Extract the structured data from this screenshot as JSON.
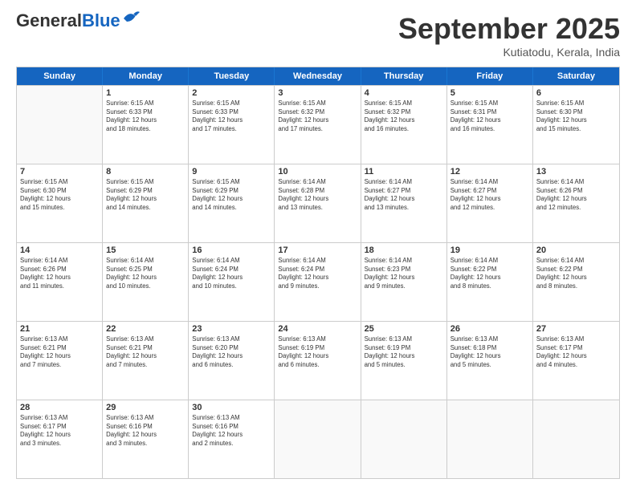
{
  "header": {
    "logo_general": "General",
    "logo_blue": "Blue",
    "month": "September 2025",
    "location": "Kutiatodu, Kerala, India"
  },
  "weekdays": [
    "Sunday",
    "Monday",
    "Tuesday",
    "Wednesday",
    "Thursday",
    "Friday",
    "Saturday"
  ],
  "rows": [
    [
      {
        "day": "",
        "info": ""
      },
      {
        "day": "1",
        "info": "Sunrise: 6:15 AM\nSunset: 6:33 PM\nDaylight: 12 hours\nand 18 minutes."
      },
      {
        "day": "2",
        "info": "Sunrise: 6:15 AM\nSunset: 6:33 PM\nDaylight: 12 hours\nand 17 minutes."
      },
      {
        "day": "3",
        "info": "Sunrise: 6:15 AM\nSunset: 6:32 PM\nDaylight: 12 hours\nand 17 minutes."
      },
      {
        "day": "4",
        "info": "Sunrise: 6:15 AM\nSunset: 6:32 PM\nDaylight: 12 hours\nand 16 minutes."
      },
      {
        "day": "5",
        "info": "Sunrise: 6:15 AM\nSunset: 6:31 PM\nDaylight: 12 hours\nand 16 minutes."
      },
      {
        "day": "6",
        "info": "Sunrise: 6:15 AM\nSunset: 6:30 PM\nDaylight: 12 hours\nand 15 minutes."
      }
    ],
    [
      {
        "day": "7",
        "info": "Sunrise: 6:15 AM\nSunset: 6:30 PM\nDaylight: 12 hours\nand 15 minutes."
      },
      {
        "day": "8",
        "info": "Sunrise: 6:15 AM\nSunset: 6:29 PM\nDaylight: 12 hours\nand 14 minutes."
      },
      {
        "day": "9",
        "info": "Sunrise: 6:15 AM\nSunset: 6:29 PM\nDaylight: 12 hours\nand 14 minutes."
      },
      {
        "day": "10",
        "info": "Sunrise: 6:14 AM\nSunset: 6:28 PM\nDaylight: 12 hours\nand 13 minutes."
      },
      {
        "day": "11",
        "info": "Sunrise: 6:14 AM\nSunset: 6:27 PM\nDaylight: 12 hours\nand 13 minutes."
      },
      {
        "day": "12",
        "info": "Sunrise: 6:14 AM\nSunset: 6:27 PM\nDaylight: 12 hours\nand 12 minutes."
      },
      {
        "day": "13",
        "info": "Sunrise: 6:14 AM\nSunset: 6:26 PM\nDaylight: 12 hours\nand 12 minutes."
      }
    ],
    [
      {
        "day": "14",
        "info": "Sunrise: 6:14 AM\nSunset: 6:26 PM\nDaylight: 12 hours\nand 11 minutes."
      },
      {
        "day": "15",
        "info": "Sunrise: 6:14 AM\nSunset: 6:25 PM\nDaylight: 12 hours\nand 10 minutes."
      },
      {
        "day": "16",
        "info": "Sunrise: 6:14 AM\nSunset: 6:24 PM\nDaylight: 12 hours\nand 10 minutes."
      },
      {
        "day": "17",
        "info": "Sunrise: 6:14 AM\nSunset: 6:24 PM\nDaylight: 12 hours\nand 9 minutes."
      },
      {
        "day": "18",
        "info": "Sunrise: 6:14 AM\nSunset: 6:23 PM\nDaylight: 12 hours\nand 9 minutes."
      },
      {
        "day": "19",
        "info": "Sunrise: 6:14 AM\nSunset: 6:22 PM\nDaylight: 12 hours\nand 8 minutes."
      },
      {
        "day": "20",
        "info": "Sunrise: 6:14 AM\nSunset: 6:22 PM\nDaylight: 12 hours\nand 8 minutes."
      }
    ],
    [
      {
        "day": "21",
        "info": "Sunrise: 6:13 AM\nSunset: 6:21 PM\nDaylight: 12 hours\nand 7 minutes."
      },
      {
        "day": "22",
        "info": "Sunrise: 6:13 AM\nSunset: 6:21 PM\nDaylight: 12 hours\nand 7 minutes."
      },
      {
        "day": "23",
        "info": "Sunrise: 6:13 AM\nSunset: 6:20 PM\nDaylight: 12 hours\nand 6 minutes."
      },
      {
        "day": "24",
        "info": "Sunrise: 6:13 AM\nSunset: 6:19 PM\nDaylight: 12 hours\nand 6 minutes."
      },
      {
        "day": "25",
        "info": "Sunrise: 6:13 AM\nSunset: 6:19 PM\nDaylight: 12 hours\nand 5 minutes."
      },
      {
        "day": "26",
        "info": "Sunrise: 6:13 AM\nSunset: 6:18 PM\nDaylight: 12 hours\nand 5 minutes."
      },
      {
        "day": "27",
        "info": "Sunrise: 6:13 AM\nSunset: 6:17 PM\nDaylight: 12 hours\nand 4 minutes."
      }
    ],
    [
      {
        "day": "28",
        "info": "Sunrise: 6:13 AM\nSunset: 6:17 PM\nDaylight: 12 hours\nand 3 minutes."
      },
      {
        "day": "29",
        "info": "Sunrise: 6:13 AM\nSunset: 6:16 PM\nDaylight: 12 hours\nand 3 minutes."
      },
      {
        "day": "30",
        "info": "Sunrise: 6:13 AM\nSunset: 6:16 PM\nDaylight: 12 hours\nand 2 minutes."
      },
      {
        "day": "",
        "info": ""
      },
      {
        "day": "",
        "info": ""
      },
      {
        "day": "",
        "info": ""
      },
      {
        "day": "",
        "info": ""
      }
    ]
  ]
}
